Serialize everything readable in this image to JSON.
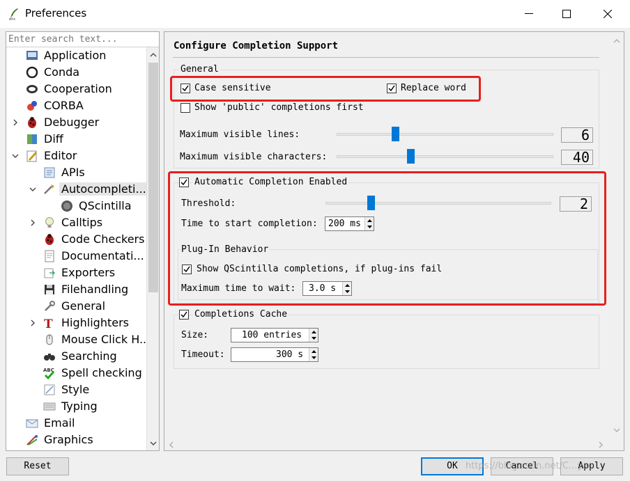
{
  "window": {
    "title": "Preferences",
    "controls": {
      "minimize": "minimize",
      "maximize": "maximize",
      "close": "close"
    }
  },
  "sidebar": {
    "search_placeholder": "Enter search text...",
    "items": [
      {
        "label": "Application",
        "icon": "application-icon",
        "expander": "none",
        "selected": false
      },
      {
        "label": "Conda",
        "icon": "conda-icon",
        "expander": "none",
        "selected": false
      },
      {
        "label": "Cooperation",
        "icon": "cooperation-icon",
        "expander": "none",
        "selected": false
      },
      {
        "label": "CORBA",
        "icon": "corba-icon",
        "expander": "none",
        "selected": false
      },
      {
        "label": "Debugger",
        "icon": "bug-icon",
        "expander": "collapsed",
        "selected": false
      },
      {
        "label": "Diff",
        "icon": "diff-icon",
        "expander": "none",
        "selected": false
      },
      {
        "label": "Editor",
        "icon": "editor-icon",
        "expander": "expanded",
        "selected": false
      },
      {
        "label": "APIs",
        "icon": "apis-icon",
        "expander": "none",
        "selected": false
      },
      {
        "label": "Autocompleti...",
        "icon": "autocompletion-icon",
        "expander": "expanded",
        "selected": true
      },
      {
        "label": "QScintilla",
        "icon": "qscintilla-icon",
        "expander": "none",
        "selected": false
      },
      {
        "label": "Calltips",
        "icon": "lightbulb-icon",
        "expander": "collapsed",
        "selected": false
      },
      {
        "label": "Code Checkers",
        "icon": "bug-icon",
        "expander": "none",
        "selected": false
      },
      {
        "label": "Documentati...",
        "icon": "documentation-icon",
        "expander": "none",
        "selected": false
      },
      {
        "label": "Exporters",
        "icon": "exporters-icon",
        "expander": "none",
        "selected": false
      },
      {
        "label": "Filehandling",
        "icon": "floppy-icon",
        "expander": "none",
        "selected": false
      },
      {
        "label": "General",
        "icon": "wrench-icon",
        "expander": "none",
        "selected": false
      },
      {
        "label": "Highlighters",
        "icon": "highlighter-icon",
        "expander": "collapsed",
        "selected": false
      },
      {
        "label": "Mouse Click H...",
        "icon": "mouse-icon",
        "expander": "none",
        "selected": false
      },
      {
        "label": "Searching",
        "icon": "binoculars-icon",
        "expander": "none",
        "selected": false
      },
      {
        "label": "Spell checking",
        "icon": "spellcheck-icon",
        "expander": "none",
        "selected": false
      },
      {
        "label": "Style",
        "icon": "style-icon",
        "expander": "none",
        "selected": false
      },
      {
        "label": "Typing",
        "icon": "keyboard-icon",
        "expander": "none",
        "selected": false
      },
      {
        "label": "Email",
        "icon": "email-icon",
        "expander": "none",
        "selected": false
      },
      {
        "label": "Graphics",
        "icon": "graphics-icon",
        "expander": "none",
        "selected": false
      }
    ]
  },
  "panel": {
    "heading": "Configure Completion Support",
    "general": {
      "title": "General",
      "case_sensitive": {
        "label": "Case sensitive",
        "checked": true
      },
      "replace_word": {
        "label": "Replace word",
        "checked": true
      },
      "show_public": {
        "label": "Show 'public' completions first",
        "checked": false
      },
      "max_lines": {
        "label": "Maximum visible lines:",
        "value": "6",
        "fraction": 0.27
      },
      "max_chars": {
        "label": "Maximum visible characters:",
        "value": "40",
        "fraction": 0.34
      }
    },
    "auto": {
      "title": "Automatic Completion Enabled",
      "checked": true,
      "threshold": {
        "label": "Threshold:",
        "value": "2",
        "fraction": 0.2
      },
      "time_start": {
        "label": "Time to start completion:",
        "value": "200 ms"
      }
    },
    "plugin": {
      "title": "Plug-In Behavior",
      "show_qsci": {
        "label": "Show QScintilla completions, if plug-ins fail",
        "checked": true
      },
      "max_wait": {
        "label": "Maximum time to wait:",
        "value": "3.0 s"
      }
    },
    "cache": {
      "title": "Completions Cache",
      "checked": true,
      "size": {
        "label": "Size:",
        "value": "100 entries"
      },
      "timeout": {
        "label": "Timeout:",
        "value": "300 s"
      }
    }
  },
  "buttons": {
    "reset": "Reset",
    "ok": "OK",
    "cancel": "Cancel",
    "apply": "Apply"
  },
  "watermark": "https://blog.csdn.net/C...yao",
  "colors": {
    "accent": "#0078d7",
    "highlight_box": "#e81e1e"
  }
}
